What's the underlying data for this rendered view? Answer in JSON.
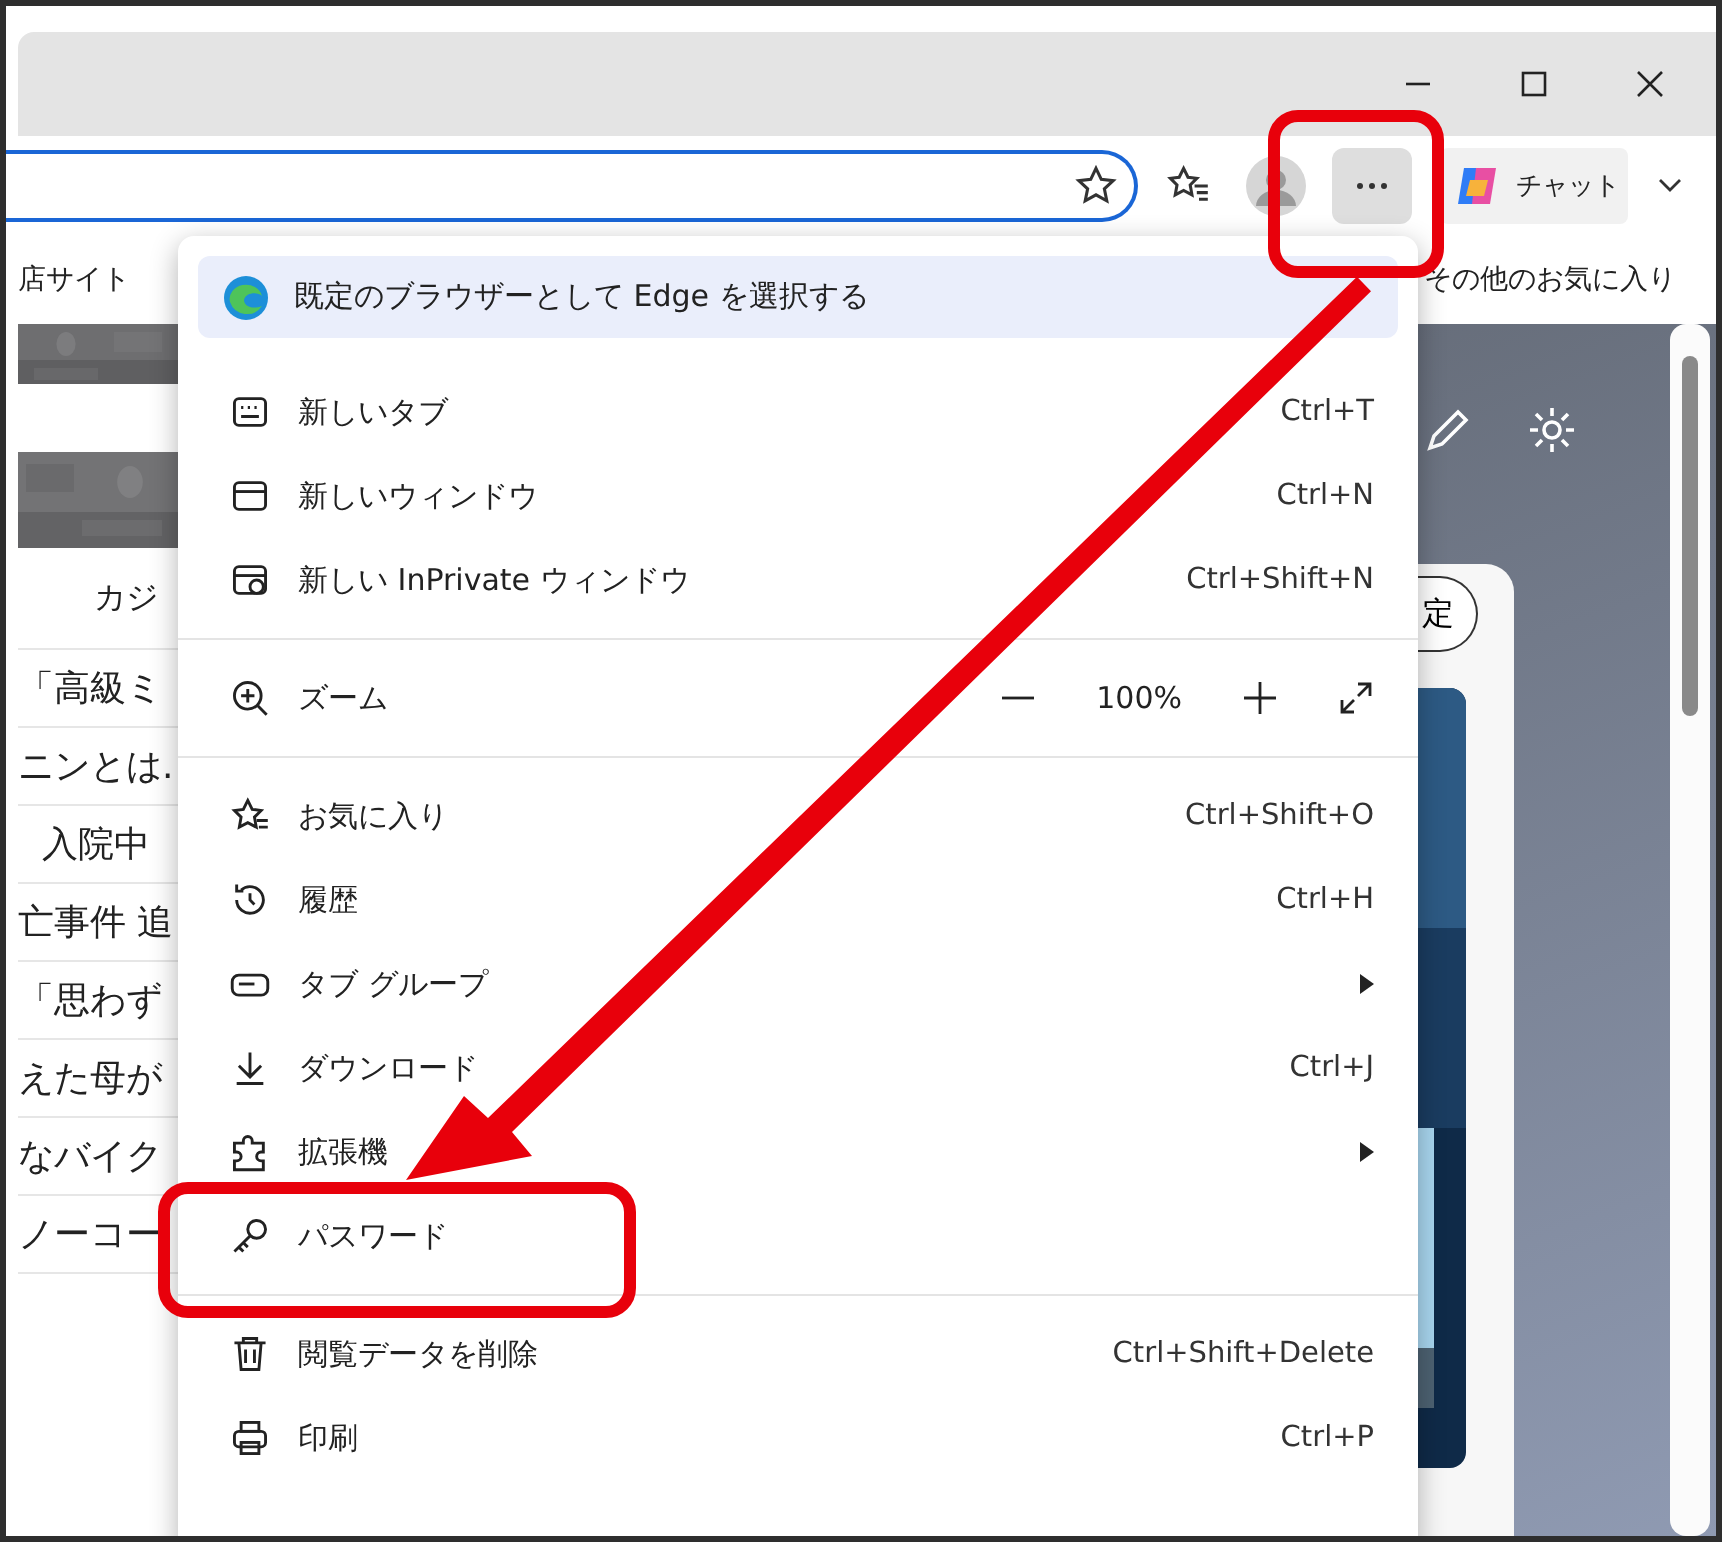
{
  "toolbar": {
    "chat_label": "チャット"
  },
  "bookmarks": {
    "items": [
      "店サイト"
    ],
    "other_favorites": "その他のお気に入り"
  },
  "page": {
    "tab_label": "カジ",
    "headlines": [
      "「高級ミ",
      "ニンとは.",
      "入院中",
      "亡事件 追",
      "「思わず",
      "えた母が",
      "なバイク",
      "ノーコー"
    ]
  },
  "side_panel": {
    "button_label": "定"
  },
  "menu": {
    "banner": "既定のブラウザーとして Edge を選択する",
    "items": [
      {
        "kind": "item",
        "label": "新しいタブ",
        "shortcut": "Ctrl+T"
      },
      {
        "kind": "item",
        "label": "新しいウィンドウ",
        "shortcut": "Ctrl+N"
      },
      {
        "kind": "item",
        "label": "新しい InPrivate ウィンドウ",
        "shortcut": "Ctrl+Shift+N"
      },
      {
        "kind": "separator"
      },
      {
        "kind": "zoom",
        "label": "ズーム",
        "value": "100%"
      },
      {
        "kind": "separator"
      },
      {
        "kind": "item",
        "label": "お気に入り",
        "shortcut": "Ctrl+Shift+O"
      },
      {
        "kind": "item",
        "label": "履歴",
        "shortcut": "Ctrl+H"
      },
      {
        "kind": "submenu",
        "label": "タブ グループ"
      },
      {
        "kind": "item",
        "label": "ダウンロード",
        "shortcut": "Ctrl+J"
      },
      {
        "kind": "submenu",
        "label": "拡張機"
      },
      {
        "kind": "item",
        "label": "パスワード"
      },
      {
        "kind": "separator"
      },
      {
        "kind": "item",
        "label": "閲覧データを削除",
        "shortcut": "Ctrl+Shift+Delete"
      },
      {
        "kind": "item",
        "label": "印刷",
        "shortcut": "Ctrl+P"
      }
    ]
  }
}
